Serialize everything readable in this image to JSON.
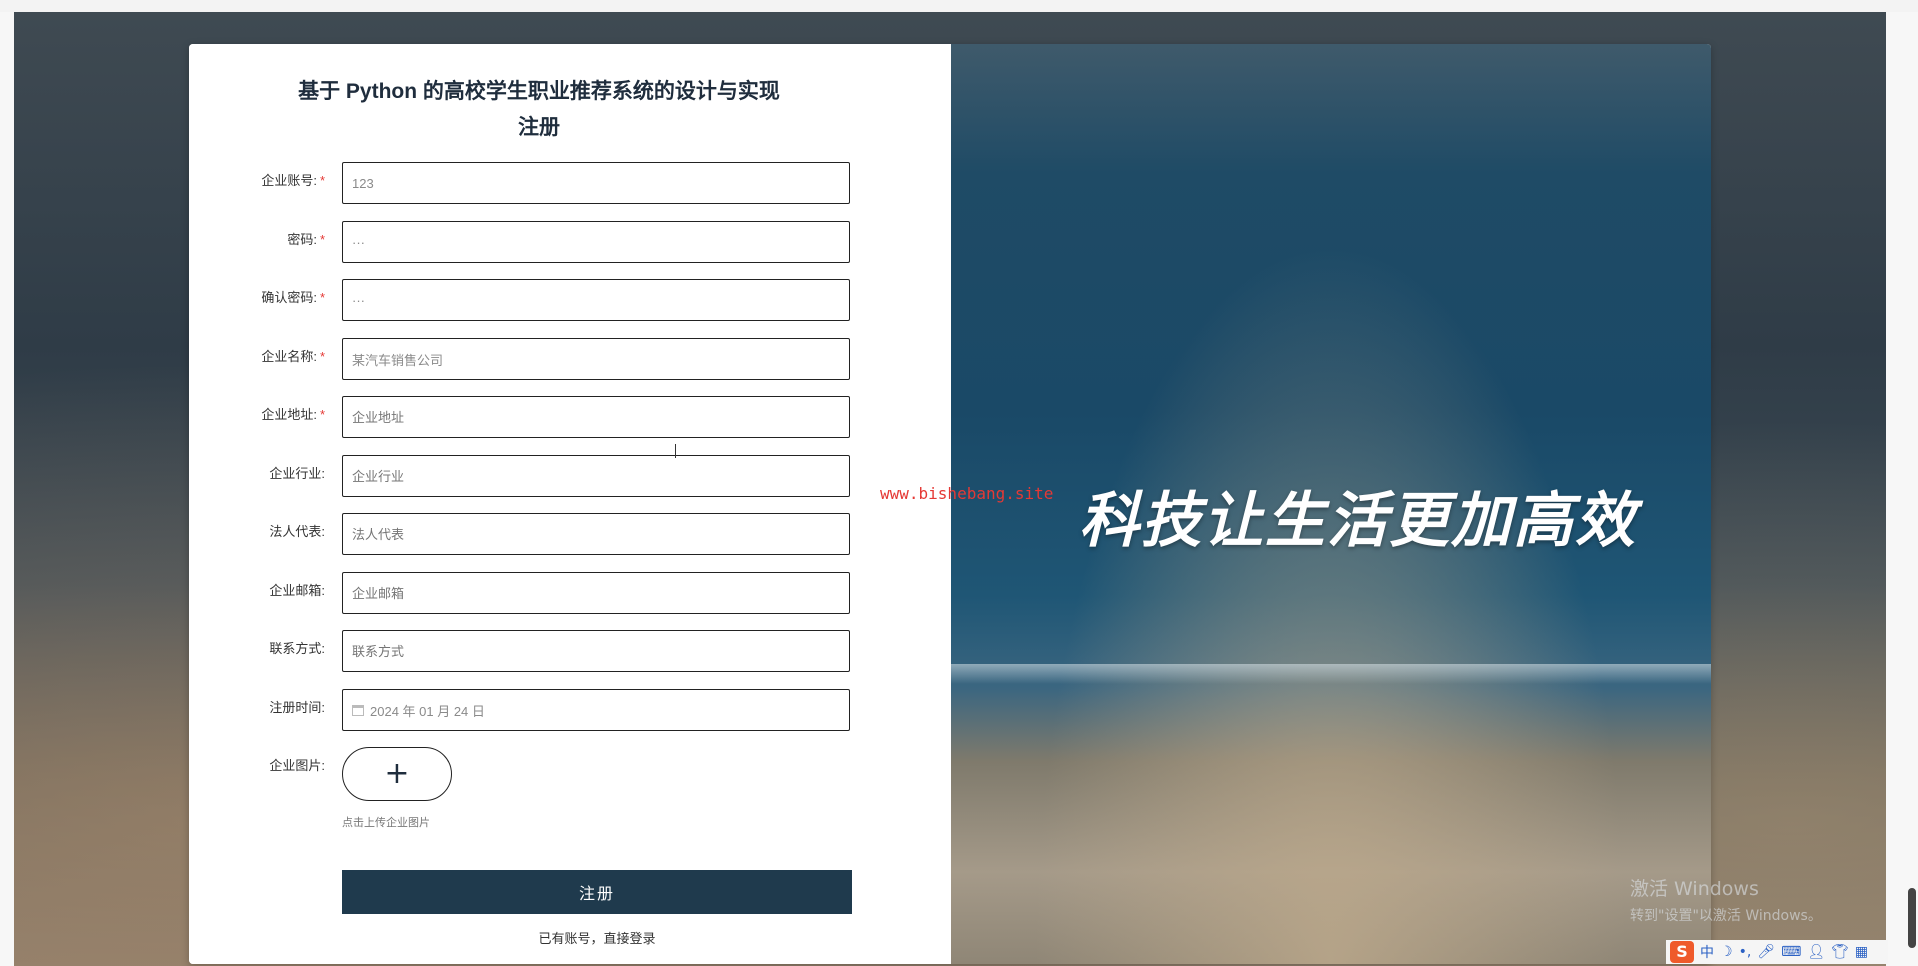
{
  "page": {
    "title_line1": "基于 Python 的高校学生职业推荐系统的设计与实现",
    "title_line2": "注册"
  },
  "form": {
    "fields": [
      {
        "label": "企业账号:",
        "required": true,
        "value": "123",
        "placeholder": "企业账号"
      },
      {
        "label": "密码:",
        "required": true,
        "value": "···",
        "placeholder": "密码"
      },
      {
        "label": "确认密码:",
        "required": true,
        "value": "···",
        "placeholder": "确认密码"
      },
      {
        "label": "企业名称:",
        "required": true,
        "value": "某汽车销售公司",
        "placeholder": "企业名称"
      },
      {
        "label": "企业地址:",
        "required": true,
        "value": "",
        "placeholder": "企业地址"
      },
      {
        "label": "企业行业:",
        "required": false,
        "value": "",
        "placeholder": "企业行业"
      },
      {
        "label": "法人代表:",
        "required": false,
        "value": "",
        "placeholder": "法人代表"
      },
      {
        "label": "企业邮箱:",
        "required": false,
        "value": "",
        "placeholder": "企业邮箱"
      },
      {
        "label": "联系方式:",
        "required": false,
        "value": "",
        "placeholder": "联系方式"
      },
      {
        "label": "注册时间:",
        "required": false,
        "value": "2024 年 01 月 24 日",
        "placeholder": ""
      }
    ],
    "upload": {
      "label": "企业图片:",
      "button_symbol": "+",
      "hint": "点击上传企业图片"
    },
    "required_mark": "*",
    "submit_label": "注册",
    "login_link": "已有账号，直接登录"
  },
  "banner": {
    "slogan": "科技让生活更加高效",
    "watermark_url": "www.bishebang.site"
  },
  "os": {
    "activation_line1": "激活 Windows",
    "activation_line2": "转到\"设置\"以激活 Windows。",
    "ime_label": "中"
  }
}
